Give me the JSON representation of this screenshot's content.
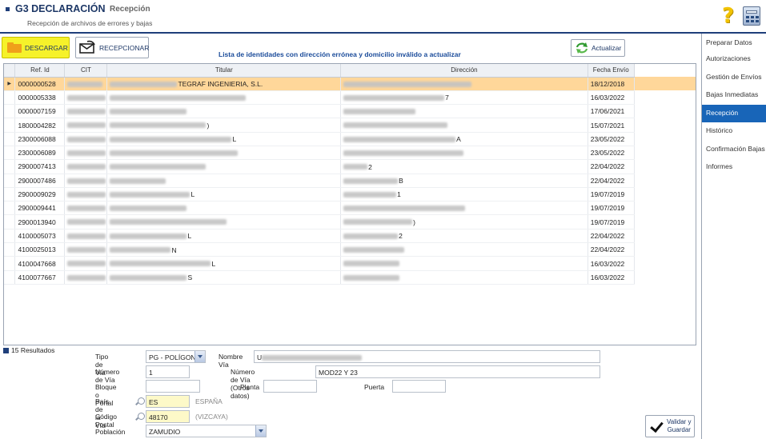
{
  "header": {
    "app_title": "G3 DECLARACIÓN",
    "section_title": "Recepción",
    "subtitle": "Recepción de archivos de errores y bajas"
  },
  "toolbar": {
    "descargar_label": "DESCARGAR",
    "recepcionar_label": "RECEPCIONAR",
    "actualizar_label": "Actualizar"
  },
  "list_title": "Lista de identidades con dirección errónea y domicilio inválido a actualizar",
  "table": {
    "columns": [
      "Ref. Id",
      "CIT",
      "Titular",
      "Dirección",
      "Fecha Envío"
    ],
    "rows": [
      {
        "ref": "0000000528",
        "cit_tail": "",
        "titular_tail": "TEGRAF INGENIERIA, S.L.",
        "dir_tail": "",
        "fecha": "18/12/2018",
        "selected": true
      },
      {
        "ref": "0000005338",
        "cit_tail": "",
        "titular_tail": "",
        "dir_tail": "7",
        "fecha": "16/03/2022",
        "selected": false
      },
      {
        "ref": "0000007159",
        "cit_tail": "",
        "titular_tail": "",
        "dir_tail": "",
        "fecha": "17/06/2021",
        "selected": false
      },
      {
        "ref": "1800004282",
        "cit_tail": "",
        "titular_tail": ")",
        "dir_tail": "",
        "fecha": "15/07/2021",
        "selected": false
      },
      {
        "ref": "2300006088",
        "cit_tail": "",
        "titular_tail": "L",
        "dir_tail": "A",
        "fecha": "23/05/2022",
        "selected": false
      },
      {
        "ref": "2300006089",
        "cit_tail": "",
        "titular_tail": "",
        "dir_tail": "",
        "fecha": "23/05/2022",
        "selected": false
      },
      {
        "ref": "2900007413",
        "cit_tail": "",
        "titular_tail": "",
        "dir_tail": "2",
        "fecha": "22/04/2022",
        "selected": false
      },
      {
        "ref": "2900007486",
        "cit_tail": "",
        "titular_tail": "",
        "dir_tail": "B",
        "fecha": "22/04/2022",
        "selected": false
      },
      {
        "ref": "2900009029",
        "cit_tail": "",
        "titular_tail": "L",
        "dir_tail": "1",
        "fecha": "19/07/2019",
        "selected": false
      },
      {
        "ref": "2900009441",
        "cit_tail": "",
        "titular_tail": "",
        "dir_tail": "",
        "fecha": "19/07/2019",
        "selected": false
      },
      {
        "ref": "2900013940",
        "cit_tail": "",
        "titular_tail": "",
        "dir_tail": ")",
        "fecha": "19/07/2019",
        "selected": false
      },
      {
        "ref": "4100005073",
        "cit_tail": "",
        "titular_tail": "L",
        "dir_tail": "2",
        "fecha": "22/04/2022",
        "selected": false
      },
      {
        "ref": "4100025013",
        "cit_tail": "",
        "titular_tail": "N",
        "dir_tail": "",
        "fecha": "22/04/2022",
        "selected": false
      },
      {
        "ref": "4100047668",
        "cit_tail": "",
        "titular_tail": "L",
        "dir_tail": "",
        "fecha": "16/03/2022",
        "selected": false
      },
      {
        "ref": "4100077667",
        "cit_tail": "",
        "titular_tail": "S",
        "dir_tail": "",
        "fecha": "16/03/2022",
        "selected": false
      }
    ]
  },
  "results_label": "15 Resultados",
  "form": {
    "tipo_via_label": "Tipo de Vía",
    "tipo_via_value": "PG - POLÍGONC",
    "nombre_via_label": "Nombre Vía",
    "nombre_via_value": "U",
    "numero_via_label": "Número de Vía",
    "numero_via_value": "1",
    "numero_otros_label": "Número de Vía (Otros datos)",
    "numero_otros_value": "MOD22 Y 23",
    "bloque_label": "Bloque o Portal",
    "bloque_value": "",
    "planta_label": "Planta",
    "planta_value": "",
    "puerta_label": "Puerta",
    "puerta_value": "",
    "pais_label": "País de la Vía",
    "pais_value": "ES",
    "pais_name": "ESPAÑA",
    "cp_label": "Código Postal",
    "cp_value": "48170",
    "cp_province": "(VIZCAYA)",
    "poblacion_label": "Población",
    "poblacion_value": "ZAMUDIO"
  },
  "validar": {
    "line1": "Validar y",
    "line2": "Guardar"
  },
  "sidebar": {
    "items": [
      {
        "label": "Preparar Datos",
        "active": false
      },
      {
        "label": "Autorizaciones",
        "active": false
      },
      {
        "label": "Gestión de Envíos",
        "active": false
      },
      {
        "label": "Bajas Inmediatas",
        "active": false
      },
      {
        "label": "Recepción",
        "active": true
      },
      {
        "label": "Histórico",
        "active": false
      },
      {
        "label": "Confirmación Bajas",
        "active": false
      },
      {
        "label": "Informes",
        "active": false
      }
    ]
  },
  "colors": {
    "accent": "#1f3f7a",
    "selected_row": "#ffd79a",
    "download_button": "#f6f22a",
    "sidebar_active": "#1865b8"
  },
  "icons": [
    "help-icon",
    "calculator-icon",
    "folder-icon",
    "mail-icon",
    "refresh-icon",
    "search-icon",
    "check-icon",
    "combo-arrow-icon"
  ]
}
